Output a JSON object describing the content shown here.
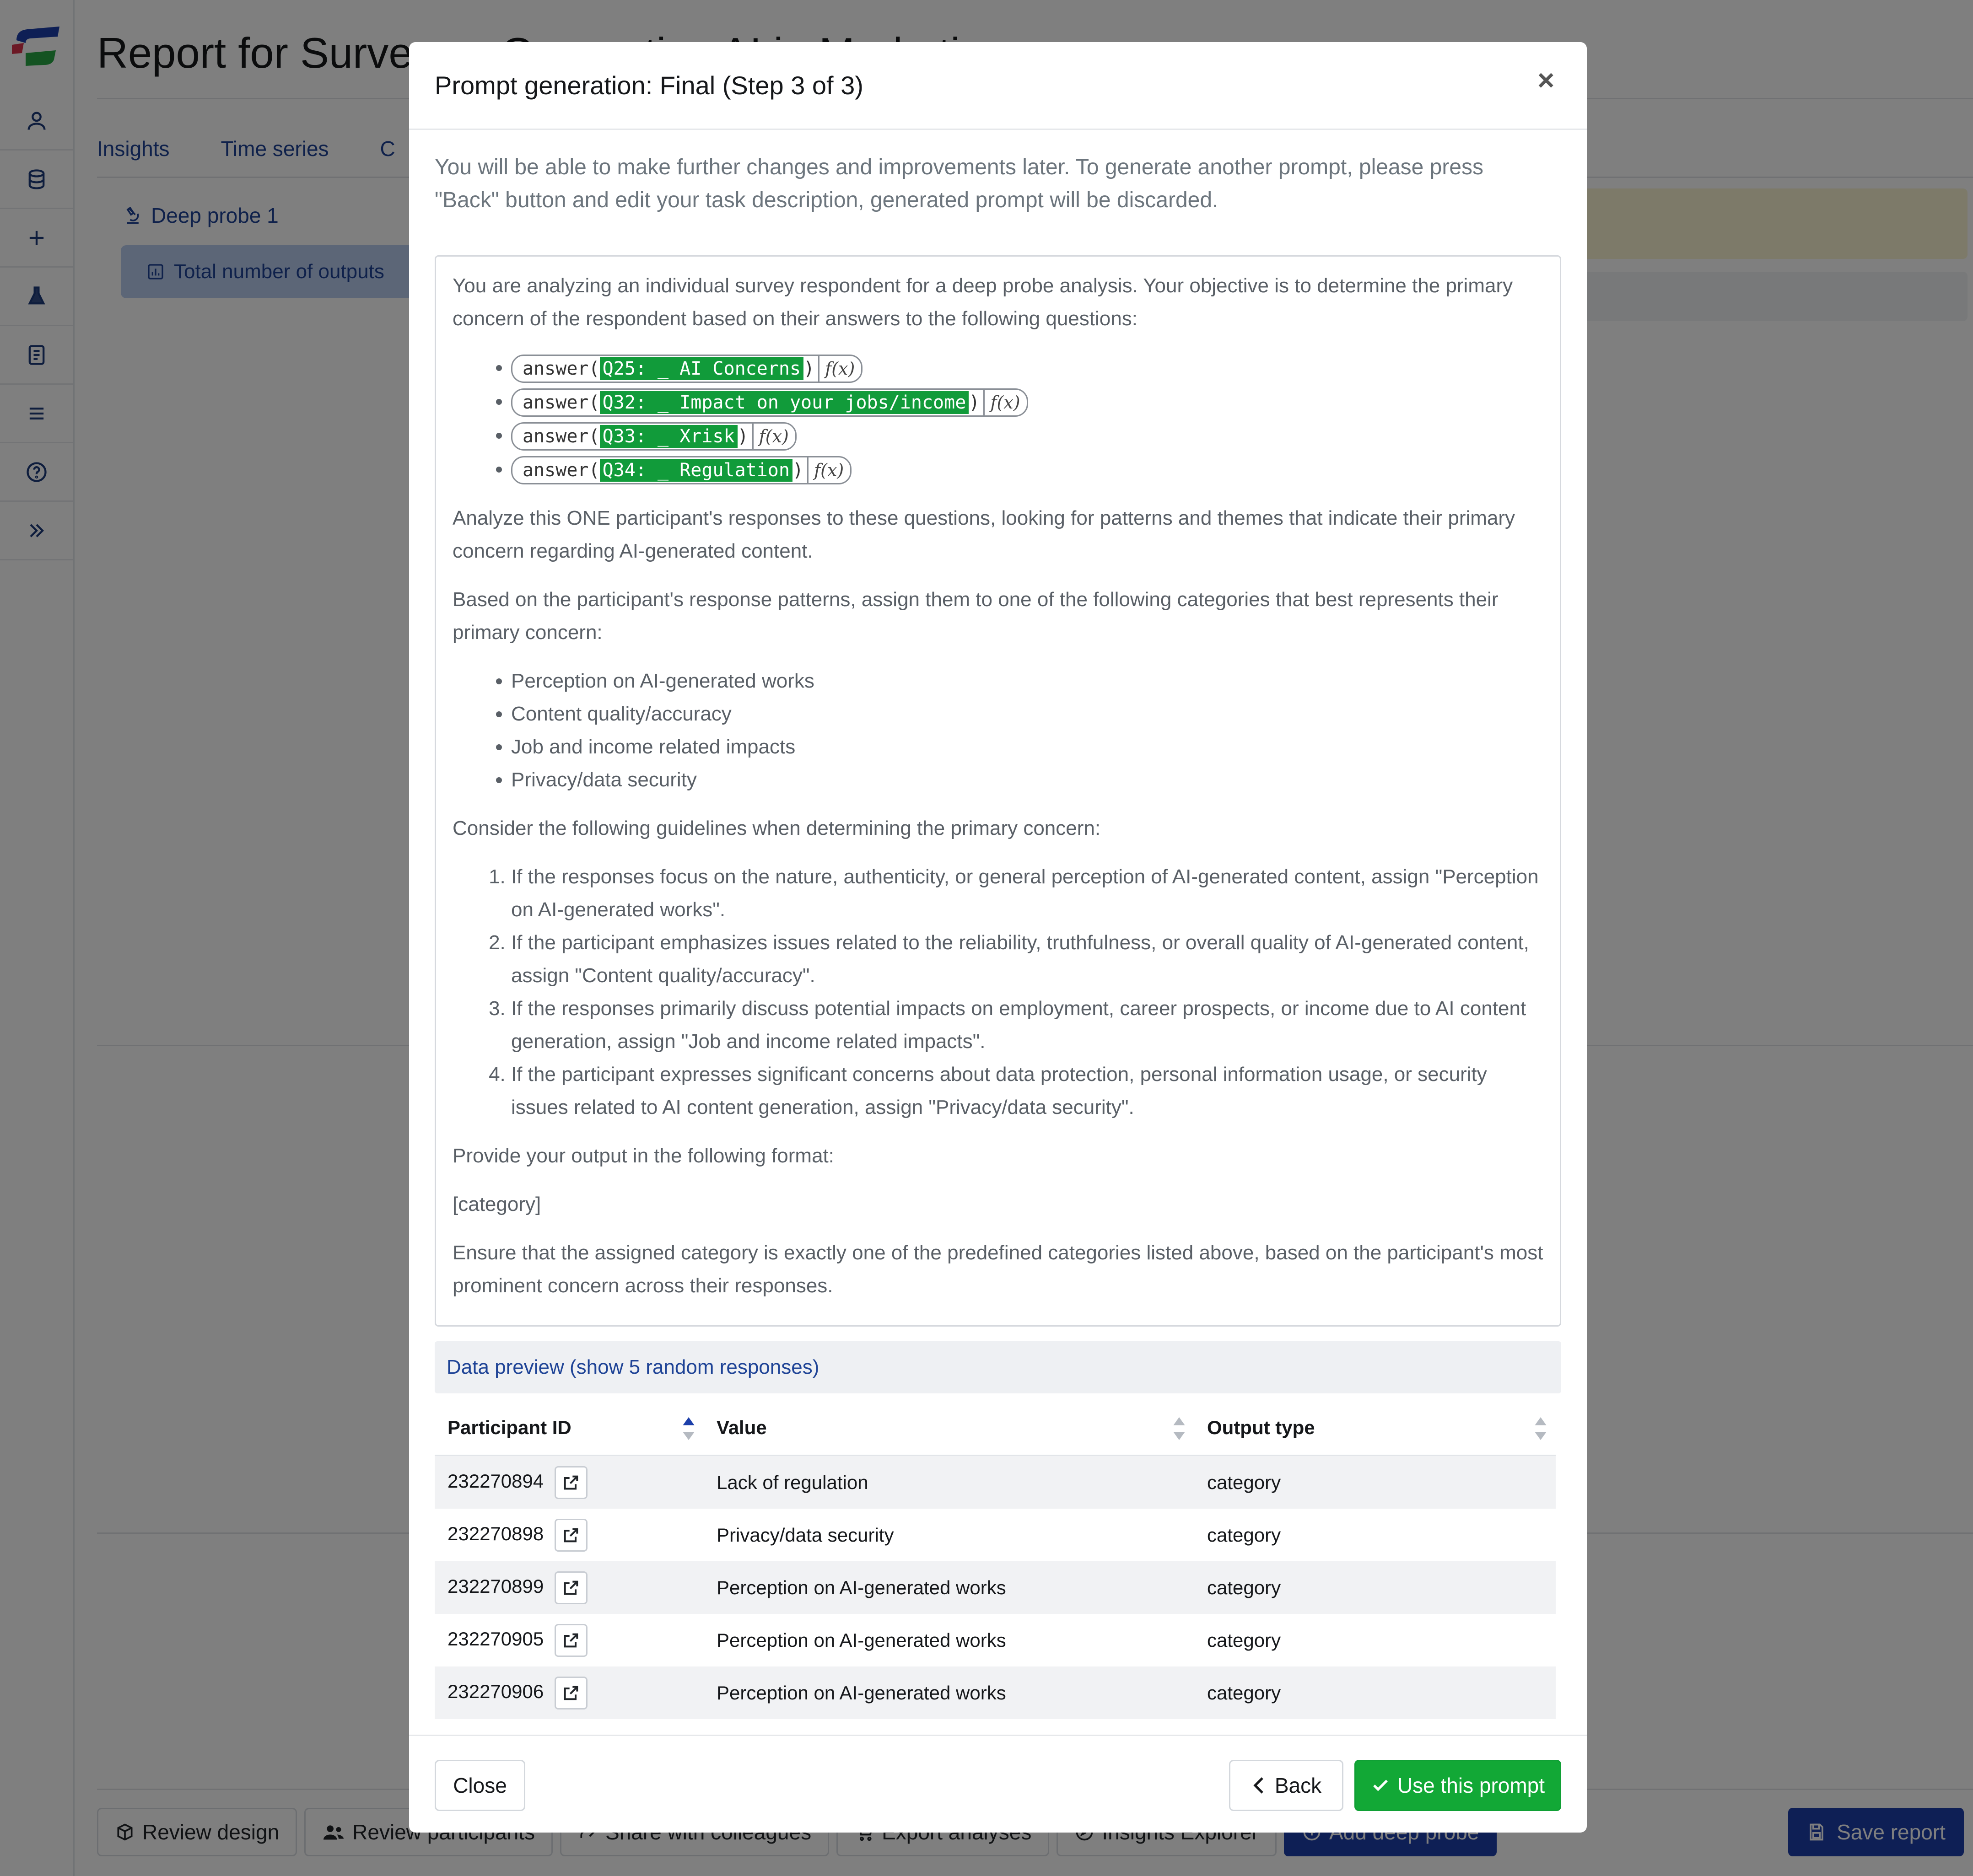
{
  "report": {
    "title": "Report for Survey — Generative AI in Marketing",
    "tabs": [
      "Insights",
      "Time series",
      "C"
    ],
    "deep_probe_label": "Deep probe 1",
    "outputs_item_label": "Total number of outputs"
  },
  "sidebar": {
    "icons": [
      "user-icon",
      "database-icon",
      "plus-icon",
      "flask-icon",
      "notebook-icon",
      "menu-icon",
      "help-icon",
      "expand-icon"
    ]
  },
  "toolbar": {
    "buttons": [
      "Review design",
      "Review participants",
      "Share with colleagues",
      "Export analyses",
      "Insights Explorer",
      "Add deep probe"
    ],
    "save_label": "Save report"
  },
  "modal": {
    "title": "Prompt generation: Final (Step 3 of 3)",
    "close_symbol": "×",
    "intro": "You will be able to make further changes and improvements later. To generate another prompt, please press \"Back\" button and edit your task description, generated prompt will be discarded.",
    "prompt": {
      "p1": "You are analyzing an individual survey respondent for a deep probe analysis. Your objective is to determine the primary concern of the respondent based on their answers to the following questions:",
      "variables": [
        {
          "fn": "answer(",
          "name": "Q25: _ AI Concerns",
          "close": ")",
          "fx": "f(x)"
        },
        {
          "fn": "answer(",
          "name": "Q32: _ Impact on your jobs/income",
          "close": ")",
          "fx": "f(x)"
        },
        {
          "fn": "answer(",
          "name": "Q33: _ Xrisk",
          "close": ")",
          "fx": "f(x)"
        },
        {
          "fn": "answer(",
          "name": "Q34: _ Regulation",
          "close": ")",
          "fx": "f(x)"
        }
      ],
      "p2": "Analyze this ONE participant's responses to these questions, looking for patterns and themes that indicate their primary concern regarding AI-generated content.",
      "p3": "Based on the participant's response patterns, assign them to one of the following categories that best represents their primary concern:",
      "categories": [
        "Perception on AI-generated works",
        "Content quality/accuracy",
        "Job and income related impacts",
        "Privacy/data security"
      ],
      "p4": "Consider the following guidelines when determining the primary concern:",
      "guidelines": [
        "If the responses focus on the nature, authenticity, or general perception of AI-generated content, assign \"Perception on AI-generated works\".",
        "If the participant emphasizes issues related to the reliability, truthfulness, or overall quality of AI-generated content, assign \"Content quality/accuracy\".",
        "If the responses primarily discuss potential impacts on employment, career prospects, or income due to AI content generation, assign \"Job and income related impacts\".",
        "If the participant expresses significant concerns about data protection, personal information usage, or security issues related to AI content generation, assign \"Privacy/data security\"."
      ],
      "p5": "Provide your output in the following format:",
      "p6": "[category]",
      "p7": "Ensure that the assigned category is exactly one of the predefined categories listed above, based on the participant's most prominent concern across their responses."
    },
    "preview_toggle": "Data preview (show 5 random responses)",
    "table": {
      "headers": [
        "Participant ID",
        "Value",
        "Output type"
      ],
      "rows": [
        {
          "id": "232270894",
          "value": "Lack of regulation",
          "type": "category"
        },
        {
          "id": "232270898",
          "value": "Privacy/data security",
          "type": "category"
        },
        {
          "id": "232270899",
          "value": "Perception on AI-generated works",
          "type": "category"
        },
        {
          "id": "232270905",
          "value": "Perception on AI-generated works",
          "type": "category"
        },
        {
          "id": "232270906",
          "value": "Perception on AI-generated works",
          "type": "category"
        }
      ]
    },
    "footer": {
      "close_label": "Close",
      "back_label": "Back",
      "use_label": "Use this prompt"
    }
  },
  "colors": {
    "accent": "#1c3faa",
    "success": "#12a836",
    "variable_highlight": "#119b3a",
    "link": "#1e4396"
  }
}
